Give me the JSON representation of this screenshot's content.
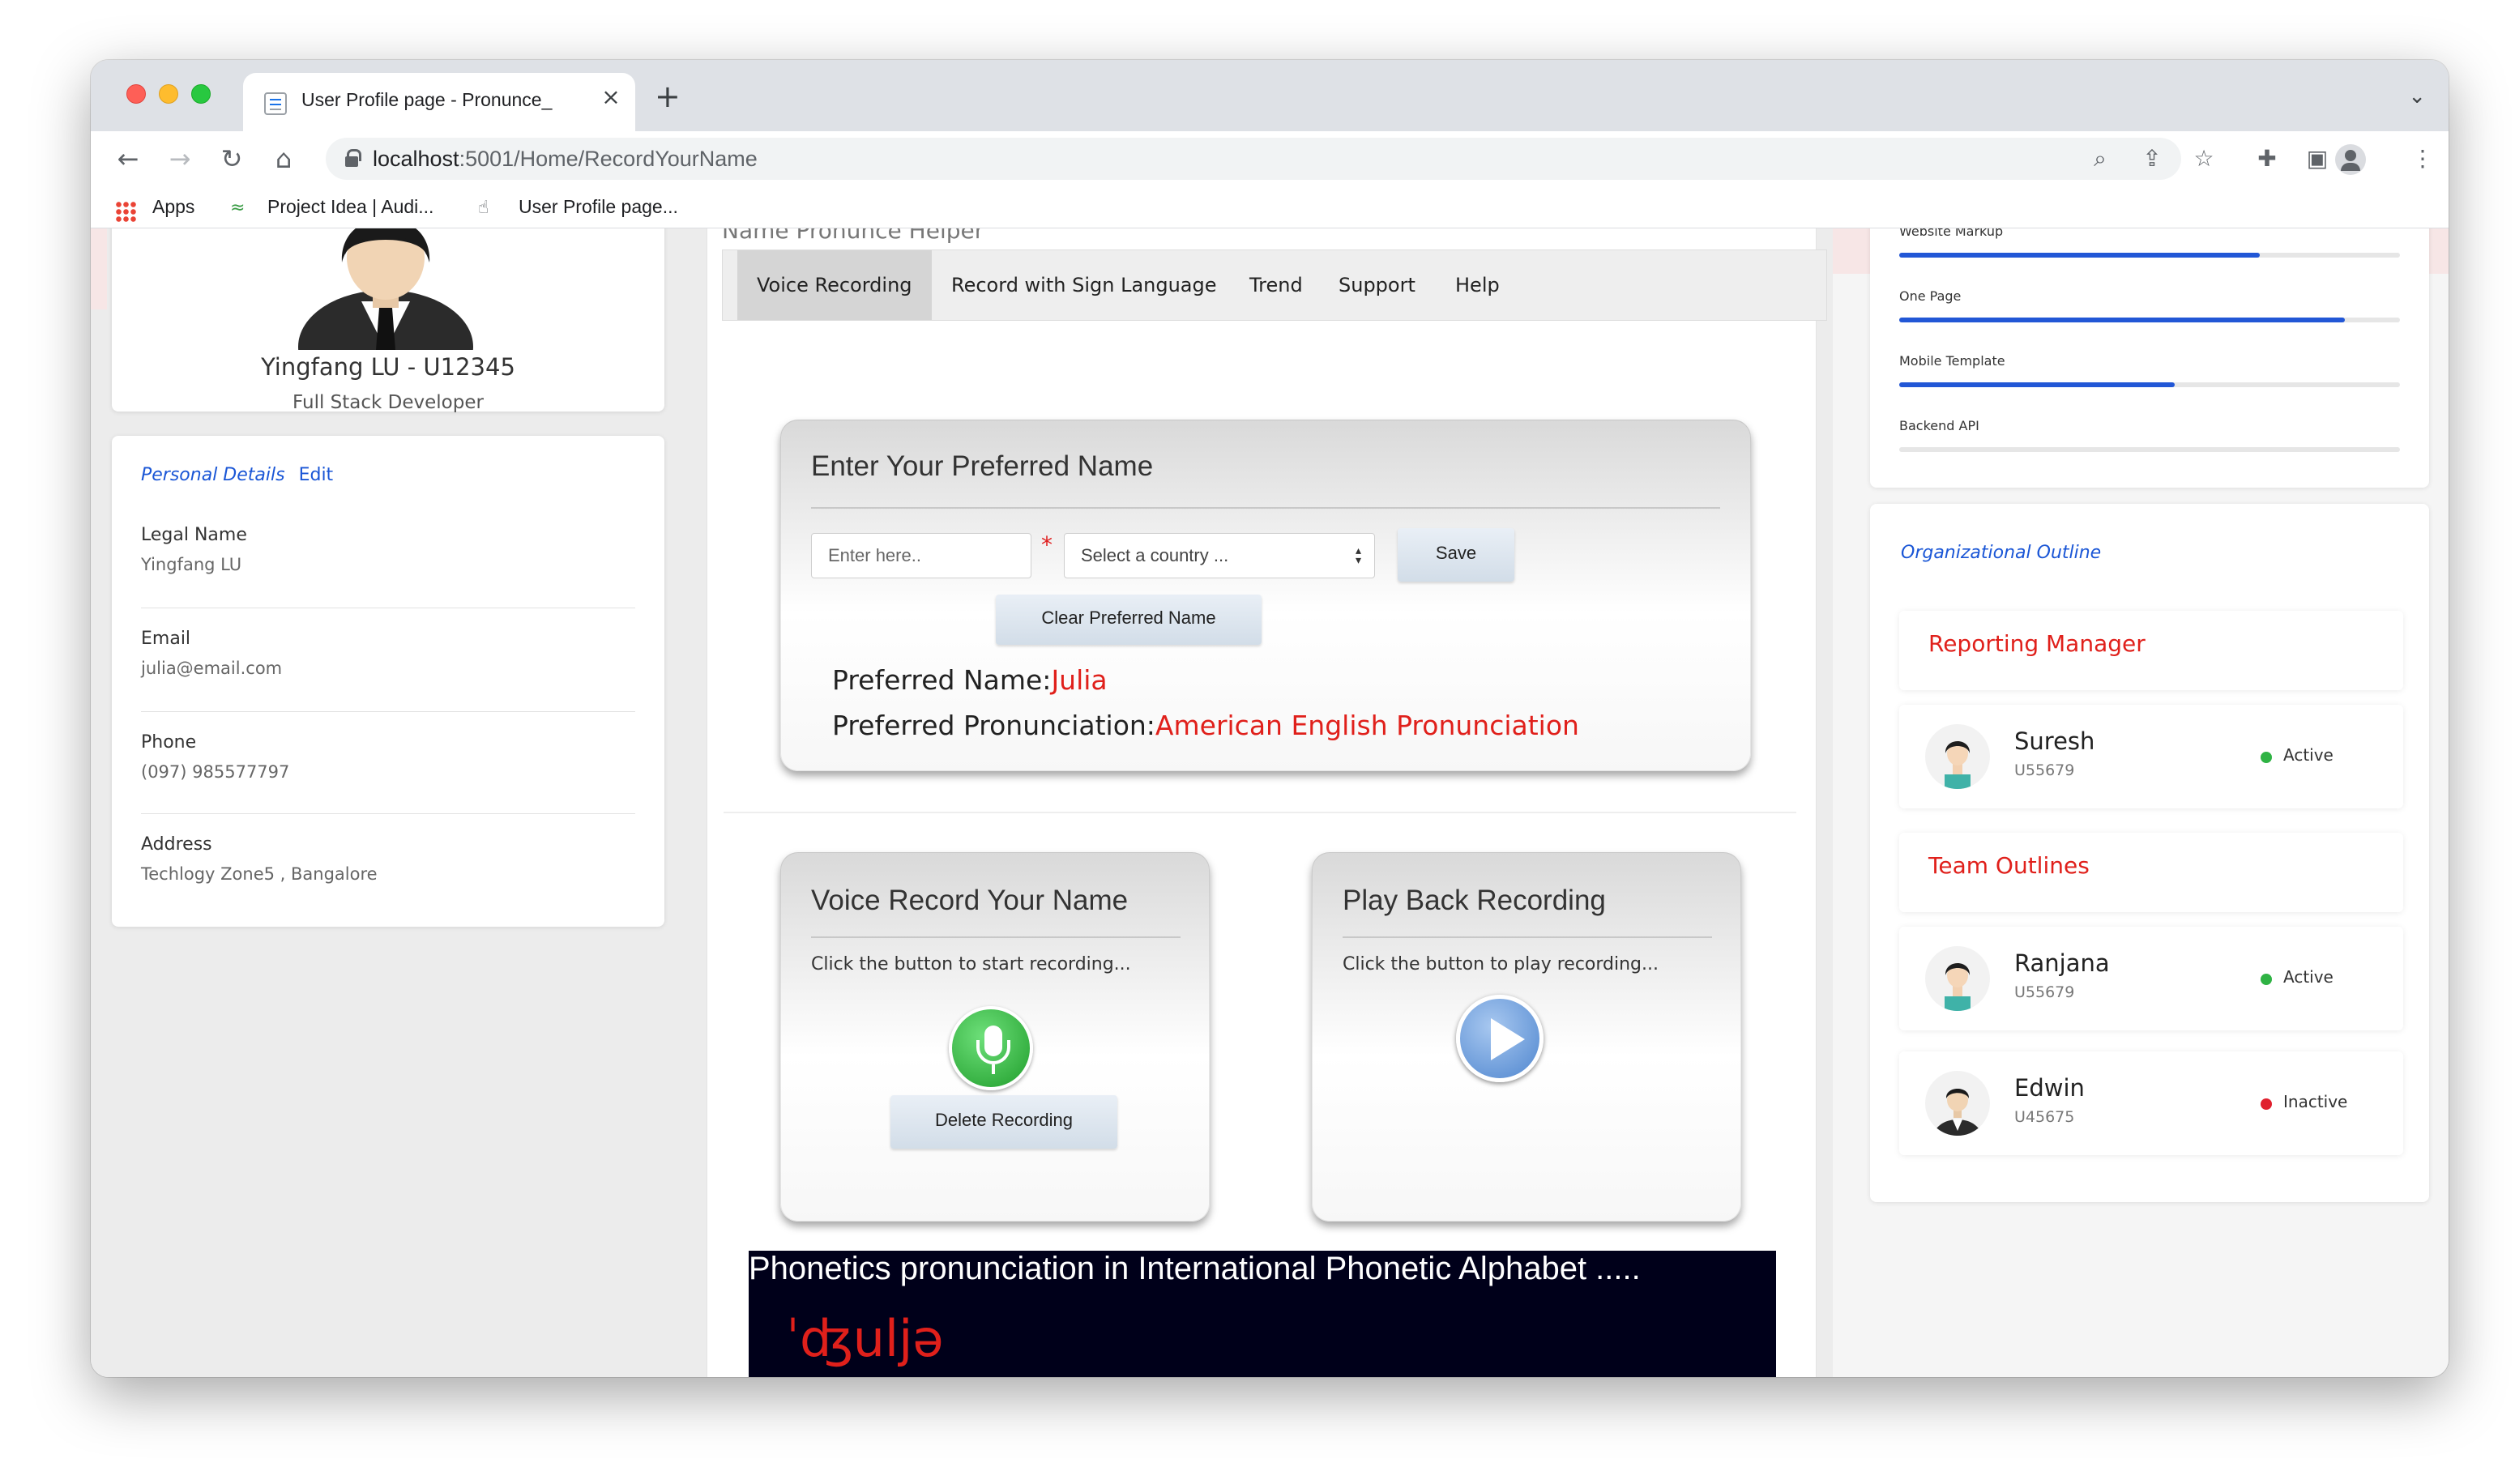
{
  "browser": {
    "tab_title": "User Profile page - Pronunce_",
    "tab_close": "×",
    "new_tab": "+",
    "url_host": "localhost",
    "url_path": ":5001/Home/RecordYourName",
    "bookmarks": [
      {
        "label": "Apps"
      },
      {
        "label": "Project Idea | Audi..."
      },
      {
        "label": "User Profile page..."
      }
    ]
  },
  "profile": {
    "name": "Yingfang LU - U12345",
    "role": "Full Stack Developer"
  },
  "personal_details": {
    "title": "Personal Details",
    "edit": "Edit",
    "fields": [
      {
        "label": "Legal Name",
        "value": "Yingfang LU"
      },
      {
        "label": "Email",
        "value": "julia@email.com"
      },
      {
        "label": "Phone",
        "value": "(097) 985577797"
      },
      {
        "label": "Address",
        "value": "Techlogy Zone5 , Bangalore"
      }
    ]
  },
  "center": {
    "page_heading": "Name Pronunce Helper",
    "tabs": [
      "Voice Recording",
      "Record with Sign Language",
      "Trend",
      "Support",
      "Help"
    ],
    "preferred": {
      "title": "Enter Your Preferred Name",
      "name_placeholder": "Enter here..",
      "required_mark": "*",
      "country_placeholder": "Select a country ...",
      "save_label": "Save",
      "clear_label": "Clear Preferred Name",
      "name_label": "Preferred Name:",
      "name_value": "Julia",
      "pron_label": "Preferred Pronunciation:",
      "pron_value": "American English Pronunciation"
    },
    "voice_record": {
      "title": "Voice Record Your Name",
      "hint": "Click the button to start recording...",
      "delete_label": "Delete Recording"
    },
    "playback": {
      "title": "Play Back Recording",
      "hint": "Click the button to play recording..."
    },
    "phonetics": {
      "title": "Phonetics pronunciation in International Phonetic Alphabet .....",
      "ipa": "ˈʤuljə"
    }
  },
  "skills": [
    {
      "label": "Website Markup",
      "level": 0.72
    },
    {
      "label": "One Page",
      "level": 0.89
    },
    {
      "label": "Mobile Template",
      "level": 0.55
    },
    {
      "label": "Backend API",
      "level": 0.0
    }
  ],
  "org": {
    "title": "Organizational Outline",
    "reporting_manager_title": "Reporting Manager",
    "manager": {
      "name": "Suresh",
      "id": "U55679",
      "status": "Active"
    },
    "team_title": "Team Outlines",
    "team": [
      {
        "name": "Ranjana",
        "id": "U55679",
        "status": "Active"
      },
      {
        "name": "Edwin",
        "id": "U45675",
        "status": "Inactive"
      }
    ]
  },
  "colors": {
    "accent_blue": "#1a56d6",
    "accent_red": "#e0201b",
    "active_green": "#2fb344",
    "inactive_red": "#e0202e"
  }
}
